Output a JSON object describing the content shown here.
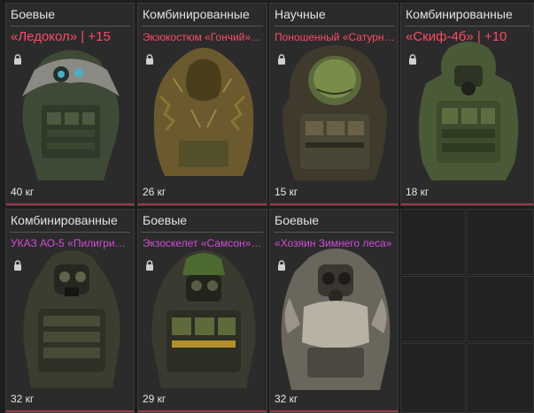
{
  "colors": {
    "legendary": "#ff4a64",
    "epic": "#d24bd8",
    "weight_bar": "#9b3a4a"
  },
  "items": [
    {
      "category": "Боевые",
      "name": "«Ледокол» | +15",
      "rarity": "legendary",
      "weight": "40 кг",
      "icon": "lock-icon"
    },
    {
      "category": "Комбинированные",
      "name": "Экзокостюм «Гончий» | ...",
      "rarity": "legendary",
      "weight": "26 кг",
      "icon": "lock-icon"
    },
    {
      "category": "Научные",
      "name": "Поношенный «Сатурн» ...",
      "rarity": "legendary",
      "weight": "15 кг",
      "icon": "lock-icon"
    },
    {
      "category": "Комбинированные",
      "name": "«Скиф-4б» | +10",
      "rarity": "legendary",
      "weight": "18 кг",
      "icon": "lock-icon"
    },
    {
      "category": "Комбинированные",
      "name": "УКАЗ АО-5 «Пилигрим»...",
      "rarity": "epic",
      "weight": "32 кг",
      "icon": "lock-icon"
    },
    {
      "category": "Боевые",
      "name": "Экзоскелет «Самсон» | ...",
      "rarity": "epic",
      "weight": "29 кг",
      "icon": "lock-icon"
    },
    {
      "category": "Боевые",
      "name": "«Хозяин Зимнего леса»",
      "rarity": "epic",
      "weight": "32 кг",
      "icon": "lock-icon"
    }
  ]
}
